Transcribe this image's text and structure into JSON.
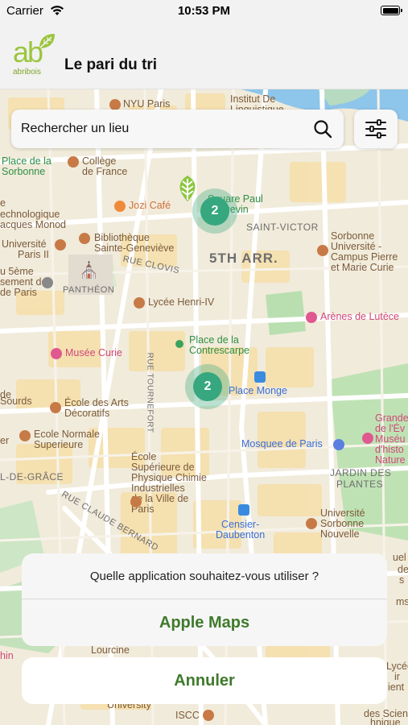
{
  "status_bar": {
    "carrier": "Carrier",
    "time": "10:53 PM"
  },
  "header": {
    "logo_text": "ab",
    "logo_brand": "abribois",
    "title": "Le pari du tri"
  },
  "search": {
    "label": "Rechercher un lieu"
  },
  "map": {
    "labels": {
      "nyu_paris": "NYU Paris",
      "institut_de": "Institut De",
      "linguistique": "Linguistique",
      "place_de_la": "Place de la",
      "sorbonne": "Sorbonne",
      "college": "Collège",
      "de_france": "de France",
      "jozi_cafe": "Jozi Café",
      "square_paul": "Square Paul",
      "langevin": "Langevin",
      "saint_victor": "SAINT-VICTOR",
      "technologique_1": "e",
      "technologique_2": "echnologique",
      "acques_monod": "acques Monod",
      "universite_paris": "Université",
      "paris_ii": "Paris II",
      "bibliotheque": "Bibliothèque",
      "sainte_genevieve": "Sainte-Geneviève",
      "fifth_arr": "5TH ARR.",
      "sorbonne_univ": "Sorbonne",
      "universite_dash": "Université -",
      "campus_pierre": "Campus Pierre",
      "et_marie_curie": "et Marie Curie",
      "rue_clovis": "RUE CLOVIS",
      "u_5eme": "u 5ème",
      "sement_de": "sement de",
      "de_paris": "de Paris",
      "pantheon": "PANTHÉON",
      "lycee_henri": "Lycée Henri-IV",
      "arenes": "Arènes de Lutèce",
      "place_de_la_2": "Place de la",
      "contrescarpe": "Contrescarpe",
      "musee_curie": "Musée Curie",
      "rue_tournefort": "RUE TOURNEFORT",
      "place_monge": "Place Monge",
      "de": "de",
      "sourds": "Sourds",
      "ecole_arts": "École des Arts",
      "decoratifs": "Décoratifs",
      "grande": "Grande",
      "de_l_ev": "de l'Év",
      "musee_n": "Muséu",
      "d_histo": "d'histo",
      "nature": "Nature",
      "ecole_normale": "Ecole Normale",
      "superieure": "Superieure",
      "er": "er",
      "mosquee": "Mosquee de Paris",
      "de_grace": "L-DE-GRÂCE",
      "ecole_sup": "École",
      "sup_de": "Supérieure de",
      "physique": "Physique Chimie",
      "industrielles": "Industrielles",
      "de_la_ville": "de la Ville de",
      "paris_word": "Paris",
      "jardin_des": "JARDIN DES",
      "plantes": "PLANTES",
      "rue_claude": "RUE CLAUDE BERNARD",
      "universite_sorbonne": "Université",
      "sorbonne_n": "Sorbonne",
      "nouvelle": "Nouvelle",
      "censier": "Censier-",
      "daubenton": "Daubenton",
      "lourcine": "Lourcine",
      "university": "University",
      "iscc": "ISCC",
      "lycee_r": "Lycée",
      "ir": "ir",
      "ient": "ient",
      "des_sciences": "des Sciences",
      "hnique": "hnique",
      "de_r": "de",
      "s_r": "s",
      "ms": "ms",
      "uel": "uel",
      "hin": "hin"
    }
  },
  "clusters": {
    "top": "2",
    "bottom": "2"
  },
  "action_sheet": {
    "question": "Quelle application souhaitez-vous utiliser ?",
    "option_apple_maps": "Apple Maps",
    "cancel": "Annuler"
  },
  "colors": {
    "accent": "#3f7a2c",
    "cluster": "#36a77f",
    "logo": "#9bc53d"
  }
}
